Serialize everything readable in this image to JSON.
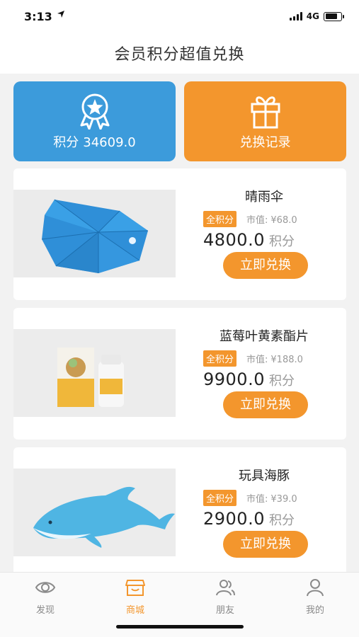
{
  "status_bar": {
    "time": "3:13",
    "network": "4G"
  },
  "header": {
    "title": "会员积分超值兑换"
  },
  "cards": {
    "points_label": "积分",
    "points_value": "34609.0",
    "records_label": "兑换记录"
  },
  "products": [
    {
      "name": "晴雨伞",
      "tag": "全积分",
      "market_label": "市值:",
      "market_value": "¥68.0",
      "price": "4800.0",
      "unit": "积分",
      "button": "立即兑换"
    },
    {
      "name": "蓝莓叶黄素酯片",
      "tag": "全积分",
      "market_label": "市值:",
      "market_value": "¥188.0",
      "price": "9900.0",
      "unit": "积分",
      "button": "立即兑换"
    },
    {
      "name": "玩具海豚",
      "tag": "全积分",
      "market_label": "市值:",
      "market_value": "¥39.0",
      "price": "2900.0",
      "unit": "积分",
      "button": "立即兑换"
    }
  ],
  "tabbar": {
    "items": [
      {
        "label": "发现",
        "icon": "eye-icon"
      },
      {
        "label": "商城",
        "icon": "shop-icon"
      },
      {
        "label": "朋友",
        "icon": "friends-icon"
      },
      {
        "label": "我的",
        "icon": "profile-icon"
      }
    ],
    "active_index": 1
  },
  "colors": {
    "accent": "#f3962d",
    "blue": "#3c9bdb"
  }
}
